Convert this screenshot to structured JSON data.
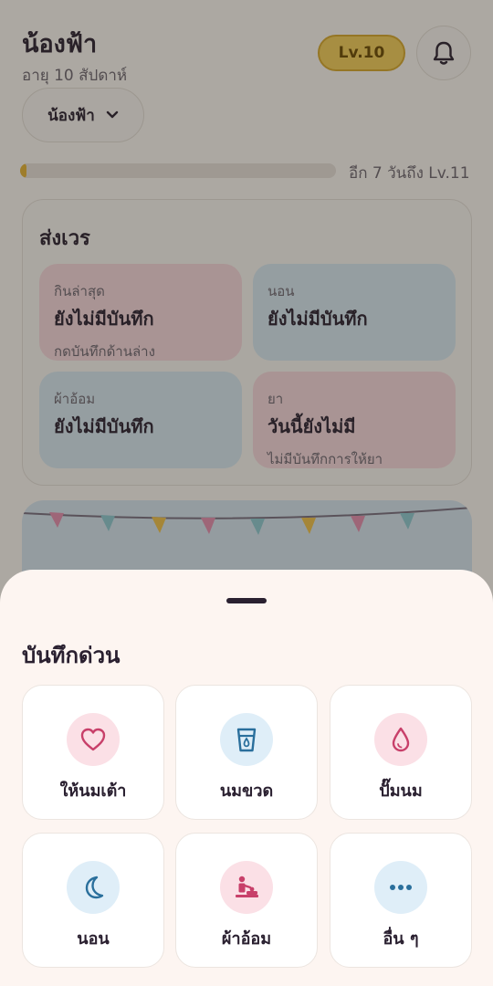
{
  "header": {
    "title": "น้องฟ้า",
    "age": "อายุ 10 สัปดาห์",
    "level_badge": "Lv.10",
    "bell_icon": "bell-icon",
    "baby_selector": "น้องฟ้า"
  },
  "progress": {
    "fraction": 0.02,
    "text": "อีก 7 วันถึง Lv.11",
    "color": "#e7b434"
  },
  "shift_card": {
    "title": "ส่งเวร",
    "tiles": [
      {
        "label": "กินล่าสุด",
        "value": "ยังไม่มีบันทึก",
        "hint": "กดบันทึกด้านล่าง"
      },
      {
        "label": "นอน",
        "value": "ยังไม่มีบันทึก",
        "hint": ""
      },
      {
        "label": "ผ้าอ้อม",
        "value": "ยังไม่มีบันทึก",
        "hint": ""
      },
      {
        "label": "ยา",
        "value": "วันนี้ยังไม่มี",
        "hint": "ไม่มีบันทึกการให้ยา"
      }
    ]
  },
  "quick_log": {
    "title": "บันทึกด่วน",
    "buttons": [
      {
        "label": "ให้นมเต้า",
        "icon": "heart-icon"
      },
      {
        "label": "นมขวด",
        "icon": "bottle-icon"
      },
      {
        "label": "ปั๊มนม",
        "icon": "drop-icon"
      },
      {
        "label": "นอน",
        "icon": "moon-icon"
      },
      {
        "label": "ผ้าอ้อม",
        "icon": "diaper-change-icon"
      },
      {
        "label": "อื่น ๆ",
        "icon": "more-dots-icon"
      }
    ]
  },
  "colors": {
    "accent_pink": "#c8406a",
    "accent_blue": "#2a6f9c",
    "level_gold": "#f6cf5a"
  }
}
